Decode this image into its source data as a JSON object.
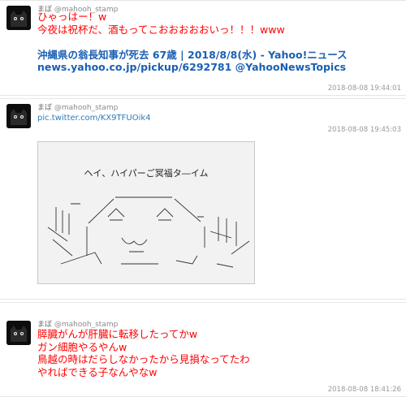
{
  "tweets": [
    {
      "name": "まぼ",
      "handle": "@mahooh_stamp",
      "lines_red": [
        "ひゃっはー！w",
        "今夜は祝杯だ、酒もってこおおおおおいっ！！！www"
      ],
      "lines_blue": [
        "沖縄県の翁長知事が死去 67歳 | 2018/8/8(水) - Yahoo!ニュース",
        "news.yahoo.co.jp/pickup/6292781 @YahooNewsTopics"
      ],
      "time": "2018-08-08 19:44:01"
    },
    {
      "name": "まぼ",
      "handle": "@mahooh_stamp",
      "link": "pic.twitter.com/KX9TFUOik4",
      "time": "2018-08-08 19:45:03",
      "image_title": "ヘイ、ハイパーご冥福タ―イム"
    },
    {
      "name": "まぼ",
      "handle": "@mahooh_stamp",
      "lines_red": [
        "膵臓がんが肝臓に転移したってかw",
        "ガン細胞やるやんw",
        "鳥越の時はだらしなかったから見損なってたわ",
        "やればできる子なんやなw"
      ],
      "time": "2018-08-08 18:41:26"
    }
  ]
}
